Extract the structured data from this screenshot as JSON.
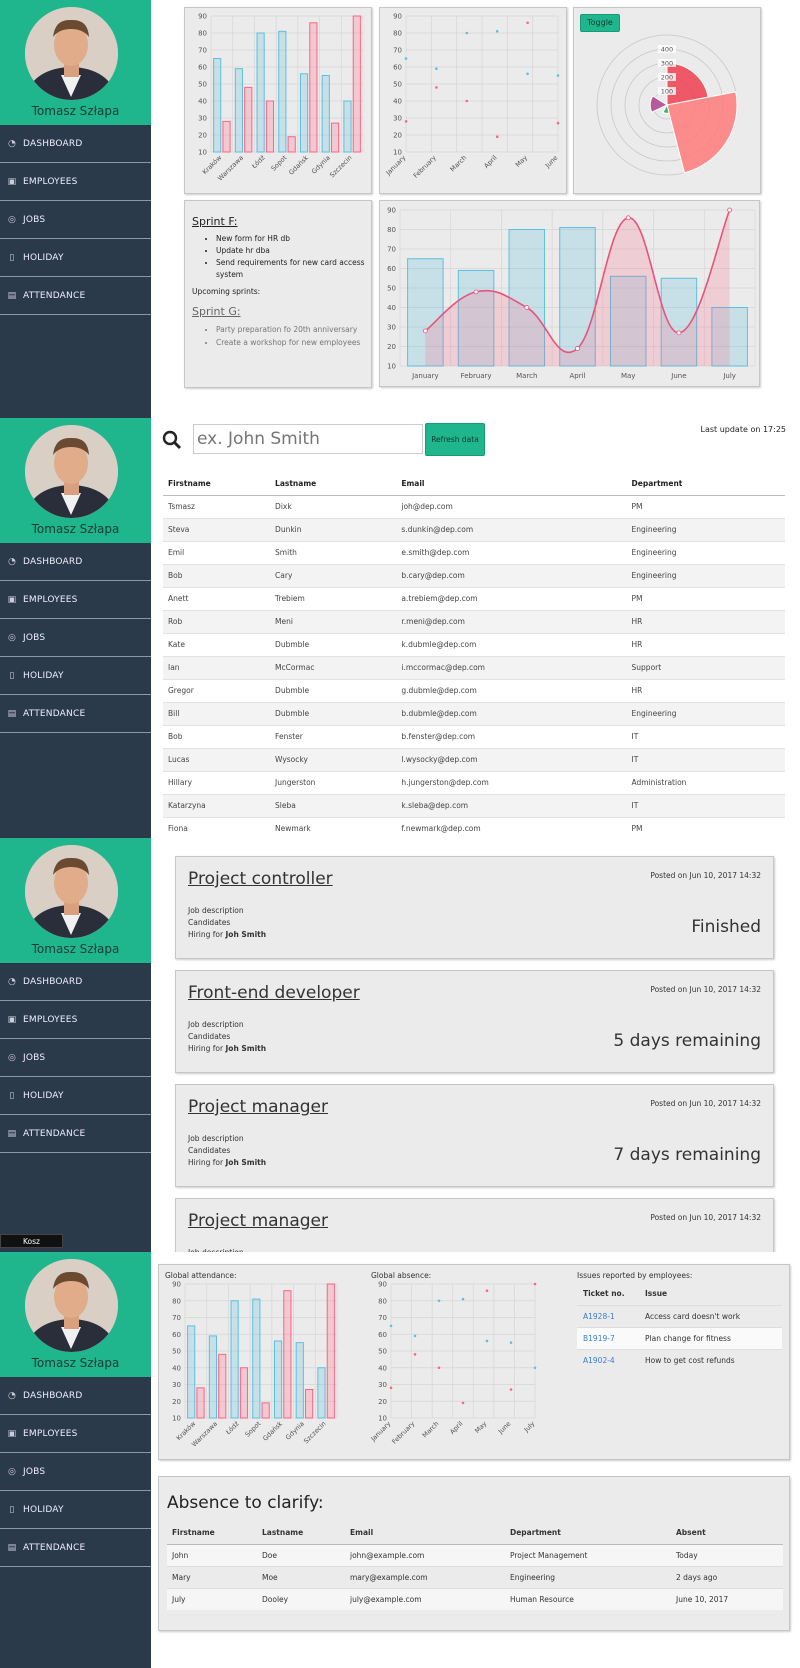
{
  "user": {
    "name": "Tomasz Szłapa"
  },
  "nav": [
    {
      "label": "DASHBOARD",
      "icon": "dashboard-icon"
    },
    {
      "label": "EMPLOYEES",
      "icon": "id-card-icon"
    },
    {
      "label": "JOBS",
      "icon": "handshake-icon"
    },
    {
      "label": "HOLIDAY",
      "icon": "bottle-icon"
    },
    {
      "label": "ATTENDANCE",
      "icon": "address-card-icon"
    }
  ],
  "colors": {
    "accent": "#1fb68e",
    "sidebar": "#2b3a4a",
    "blue": "#5bc0de",
    "pink": "#ff6384",
    "red": "#f04050",
    "green": "#20b050",
    "purple": "#b04090"
  },
  "chart_data": [
    {
      "type": "bar",
      "id": "city-bars",
      "categories": [
        "Kraków",
        "Warszawa",
        "Łódź",
        "Sopot",
        "Gdańsk",
        "Gdynia",
        "Szczecin"
      ],
      "ylim": [
        10,
        90
      ],
      "series": [
        {
          "values": [
            65,
            59,
            80,
            81,
            56,
            55,
            40
          ]
        },
        {
          "values": [
            28,
            48,
            40,
            19,
            86,
            27,
            90
          ]
        }
      ]
    },
    {
      "type": "scatter",
      "id": "month-scatter",
      "categories": [
        "January",
        "February",
        "March",
        "April",
        "May",
        "June"
      ],
      "ylim": [
        10,
        90
      ],
      "series": [
        {
          "values": [
            65,
            59,
            80,
            81,
            56,
            55
          ]
        },
        {
          "values": [
            28,
            48,
            40,
            19,
            86,
            27
          ]
        }
      ]
    },
    {
      "type": "polarArea",
      "id": "polar",
      "ticks": [
        100,
        200,
        300,
        400
      ],
      "values": [
        300,
        500,
        100,
        60,
        120
      ]
    },
    {
      "type": "bar",
      "id": "combo",
      "categories": [
        "January",
        "February",
        "March",
        "April",
        "May",
        "June",
        "July"
      ],
      "ylim": [
        10,
        90
      ],
      "series": [
        {
          "type": "bar",
          "values": [
            65,
            59,
            80,
            81,
            56,
            55,
            40
          ]
        },
        {
          "type": "line",
          "values": [
            28,
            48,
            40,
            19,
            86,
            27,
            90
          ]
        }
      ]
    },
    {
      "type": "bar",
      "id": "global-attendance",
      "categories": [
        "Kraków",
        "Warszawa",
        "Łódź",
        "Sopot",
        "Gdańsk",
        "Gdynia",
        "Szczecin"
      ],
      "ylim": [
        10,
        90
      ],
      "series": [
        {
          "values": [
            65,
            59,
            80,
            81,
            56,
            55,
            40
          ]
        },
        {
          "values": [
            28,
            48,
            40,
            19,
            86,
            27,
            90
          ]
        }
      ]
    },
    {
      "type": "scatter",
      "id": "global-absence",
      "categories": [
        "January",
        "February",
        "March",
        "April",
        "May",
        "June",
        "July"
      ],
      "ylim": [
        10,
        90
      ],
      "series": [
        {
          "values": [
            65,
            59,
            80,
            81,
            56,
            55,
            40
          ]
        },
        {
          "values": [
            28,
            48,
            40,
            19,
            86,
            27,
            90
          ]
        }
      ]
    }
  ],
  "sprints": {
    "f_title": "Sprint F:",
    "f_items": [
      "New form for HR db",
      "Update hr dba",
      "Send requirements for new card access system"
    ],
    "upcoming": "Upcoming sprints:",
    "g_title": "Sprint G:",
    "g_items": [
      "Party preparation fo 20th anniversary",
      "Create a workshop for new employees"
    ]
  },
  "toggle_label": "Toggle",
  "employees": {
    "search_placeholder": "ex. John Smith",
    "refresh_label": "Refresh data",
    "last_update": "Last update on 17:25",
    "headers": [
      "Firstname",
      "Lastname",
      "Email",
      "Department"
    ],
    "rows": [
      [
        "Tsmasz",
        "Dixk",
        "joh@dep.com",
        "PM"
      ],
      [
        "Steva",
        "Dunkin",
        "s.dunkin@dep.com",
        "Engineering"
      ],
      [
        "Emil",
        "Smith",
        "e.smith@dep.com",
        "Engineering"
      ],
      [
        "Bob",
        "Cary",
        "b.cary@dep.com",
        "Engineering"
      ],
      [
        "Anett",
        "Trebiem",
        "a.trebiem@dep.com",
        "PM"
      ],
      [
        "Rob",
        "Meni",
        "r.meni@dep.com",
        "HR"
      ],
      [
        "Kate",
        "Dubmble",
        "k.dubmle@dep.com",
        "HR"
      ],
      [
        "Ian",
        "McCormac",
        "i.mccormac@dep.com",
        "Support"
      ],
      [
        "Gregor",
        "Dubmble",
        "g.dubmle@dep.com",
        "HR"
      ],
      [
        "Bill",
        "Dubmble",
        "b.dubmle@dep.com",
        "Engineering"
      ],
      [
        "Bob",
        "Fenster",
        "b.fenster@dep.com",
        "IT"
      ],
      [
        "Lucas",
        "Wysocky",
        "l.wysocky@dep.com",
        "IT"
      ],
      [
        "Hillary",
        "Jungerston",
        "h.jungerston@dep.com",
        "Administration"
      ],
      [
        "Katarzyna",
        "Sleba",
        "k.sleba@dep.com",
        "IT"
      ],
      [
        "Fiona",
        "Newmark",
        "f.newmark@dep.com",
        "PM"
      ]
    ]
  },
  "jobs": [
    {
      "title": "Project controller",
      "posted": "Posted on Jun 10, 2017 14:32",
      "desc": "Job description",
      "cand": "Candidates",
      "hiring": "Hiring for",
      "who": "Joh Smith",
      "status": "Finished"
    },
    {
      "title": "Front-end developer",
      "posted": "Posted on Jun 10, 2017 14:32",
      "desc": "Job description",
      "cand": "Candidates",
      "hiring": "Hiring for",
      "who": "Joh Smith",
      "status": "5 days remaining"
    },
    {
      "title": "Project manager",
      "posted": "Posted on Jun 10, 2017 14:32",
      "desc": "Job description",
      "cand": "Candidates",
      "hiring": "Hiring for",
      "who": "Joh Smith",
      "status": "7 days remaining"
    },
    {
      "title": "Project manager",
      "posted": "Posted on Jun 10, 2017 14:32",
      "desc": "Job description"
    }
  ],
  "tooltip": "Kosz",
  "dashboard": {
    "attendance_title": "Global attendance:",
    "absence_title": "Global absence:",
    "issues_title": "Issues reported by employees:",
    "issue_headers": [
      "Ticket no.",
      "Issue"
    ],
    "issues": [
      [
        "A1928-1",
        "Access card doesn't work"
      ],
      [
        "B1919-7",
        "Plan change for fitness"
      ],
      [
        "A1902-4",
        "How to get cost refunds"
      ]
    ],
    "absence_heading": "Absence to clarify:",
    "abs_headers": [
      "Firstname",
      "Lastname",
      "Email",
      "Department",
      "Absent"
    ],
    "abs_rows": [
      [
        "John",
        "Doe",
        "john@example.com",
        "Project Management",
        "Today"
      ],
      [
        "Mary",
        "Moe",
        "mary@example.com",
        "Engineering",
        "2 days ago"
      ],
      [
        "July",
        "Dooley",
        "july@example.com",
        "Human Resource",
        "June 10, 2017"
      ]
    ]
  }
}
